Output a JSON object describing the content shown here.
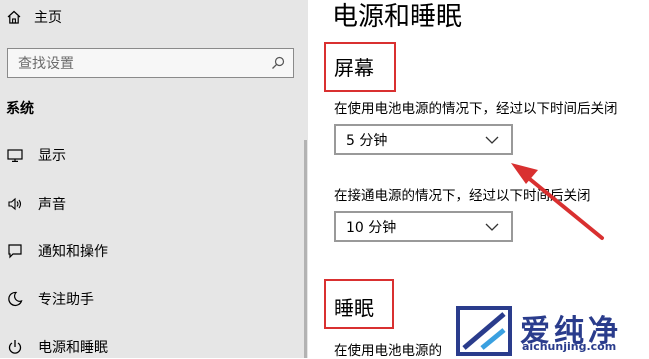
{
  "sidebar": {
    "home_label": "主页",
    "search_placeholder": "查找设置",
    "section_label": "系统",
    "items": [
      {
        "label": "显示",
        "icon": "monitor-icon"
      },
      {
        "label": "声音",
        "icon": "speaker-icon"
      },
      {
        "label": "通知和操作",
        "icon": "notification-icon"
      },
      {
        "label": "专注助手",
        "icon": "moon-icon"
      },
      {
        "label": "电源和睡眠",
        "icon": "power-icon"
      }
    ]
  },
  "main": {
    "title": "电源和睡眠",
    "screen_section": {
      "title": "屏幕",
      "battery_desc": "在使用电池电源的情况下，经过以下时间后关闭",
      "battery_value": "5 分钟",
      "plugged_desc": "在接通电源的情况下，经过以下时间后关闭",
      "plugged_value": "10 分钟"
    },
    "sleep_section": {
      "title": "睡眠",
      "battery_desc": "在使用电池电源的"
    }
  },
  "watermark": {
    "text": "爱纯净",
    "url": "aichunjing.com"
  },
  "colors": {
    "sidebar_bg": "#e6e6e6",
    "highlight": "#d93030",
    "watermark": "#2a3c8c"
  }
}
